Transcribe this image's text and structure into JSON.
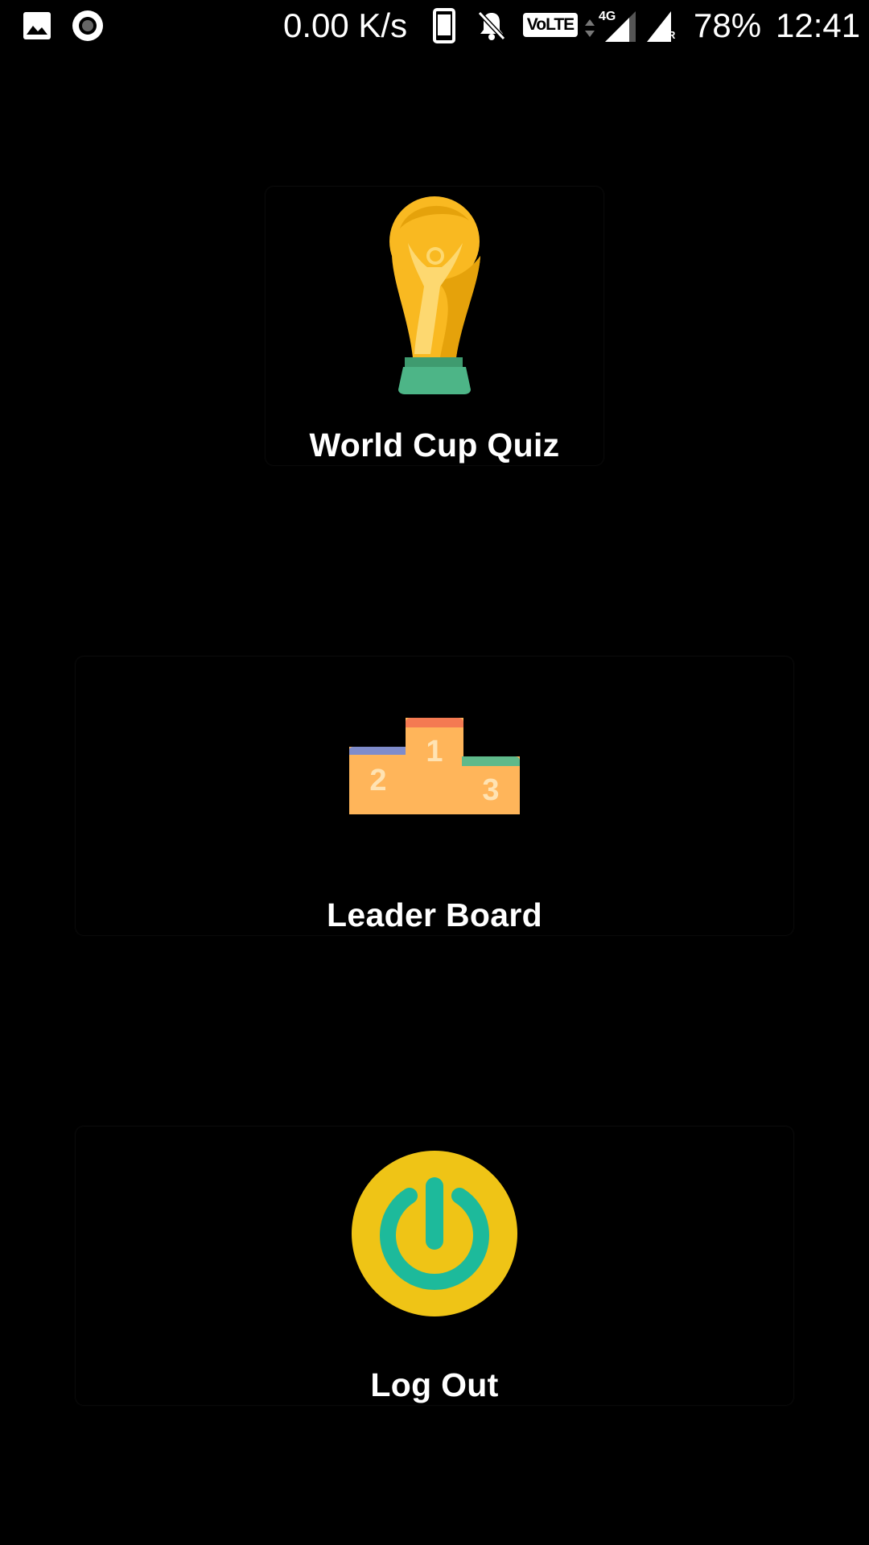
{
  "status_bar": {
    "left_icons": [
      "image-notification-icon",
      "record-notification-icon"
    ],
    "network_speed": "0.00 K/s",
    "volte_label": "VoLTE",
    "network_type": "4G",
    "roaming_label": "R",
    "battery": "78%",
    "time": "12:41"
  },
  "menu": {
    "items": [
      {
        "label": "World Cup Quiz",
        "icon": "trophy-icon"
      },
      {
        "label": "Leader Board",
        "icon": "podium-icon"
      },
      {
        "label": "Log Out",
        "icon": "power-icon"
      }
    ]
  },
  "podium": {
    "first": "1",
    "second": "2",
    "third": "3"
  },
  "colors": {
    "background": "#000000",
    "trophy_gold": "#F9B921",
    "trophy_base": "#4DB587",
    "podium_body": "#FFB55A",
    "podium_first_top": "#F47A52",
    "podium_second_top": "#7F8CCB",
    "podium_third_top": "#5FB98A",
    "power_circle": "#EFC416",
    "power_symbol": "#1DBA9B"
  }
}
